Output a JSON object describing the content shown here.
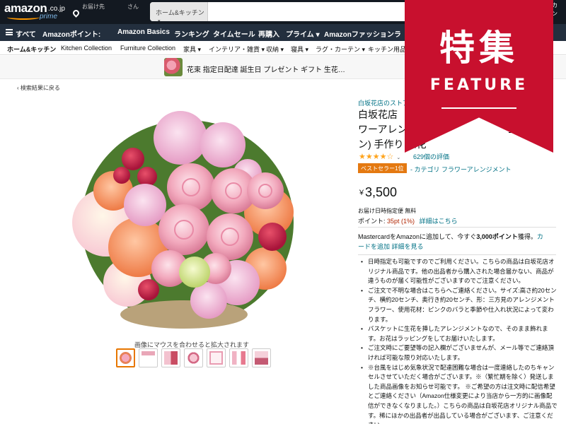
{
  "header": {
    "logo_main": "amazon",
    "logo_tld": ".co.jp",
    "logo_sub": "prime",
    "deliver_label": "お届け先",
    "deliver_name": "さん",
    "search_category": "ホーム&キッチン",
    "account_line1": "アカ",
    "account_line2": "ウン"
  },
  "nav": {
    "items": [
      "すべて",
      "Amazonポイント:",
      "Amazon Basics",
      "ランキング",
      "タイムセール",
      "再購入",
      "プライム ▾",
      "Amazonファッション",
      "ラ"
    ]
  },
  "subnav": {
    "items": [
      "ホーム&キッチン",
      "Kitchen Collection",
      "Furniture Collection",
      "家具 ▾",
      "インテリア・雑貨 ▾",
      "収納 ▾",
      "寝具 ▾",
      "ラグ・カーテン ▾",
      "キッチン用品 ▾"
    ]
  },
  "banner": {
    "text": "花束 指定日配達 誕生日 プレゼント ギフト 生花…"
  },
  "back_link": "‹ 検索結果に戻る",
  "image": {
    "zoom_hint": "画像にマウスを合わせると拡大されます",
    "thumb_count": 7
  },
  "product": {
    "store": "白坂花店のストア",
    "title": "白坂花店 ワーアレンジメ ン) 手作り 生花",
    "title_line1": "白坂花店",
    "title_line2": "ワーアレンジ",
    "title_line2b": "ョン",
    "title_line3": "ン) 手作り 生花",
    "rating": 4,
    "stars_text": "★★★★☆",
    "reviews": "629個の評価",
    "best_badge": "ベストセラー1位",
    "best_category": "- カテゴリ フラワーアレンジメント",
    "price_symbol": "￥",
    "price": "3,500",
    "delivery": "お届け日時指定便 無料",
    "points_label": "ポイント:",
    "points_value": "35pt (1%)",
    "points_link": "詳細はこちら",
    "mastercard_pre": "MastercardをAmazonに追加して、今すぐ",
    "mastercard_bold": "3,000ポイント",
    "mastercard_post": "獲得。",
    "mastercard_link1": "カ",
    "mastercard_link1b": "ードを追加",
    "mastercard_link2": "詳細を見る",
    "bullets": [
      "日時指定も可能ですのでご利用ください。こちらの商品は白坂花店オリジナル商品です。他の出品者から購入された場合届かない、商品が違うものが届く可能性がございますのでご注意ください。",
      "ご注文で不明な場合はこちらへご連絡ください。サイズ:高さ約20センチ、横約20センチ、奥行き約20センチ、形：三方見のアレンジメントフラワー、使用花材：ピンクのバラと季節や仕入れ状況によって変わります。",
      "バスケットに生花を挿したアレンジメントなので、そのまま飾れます。お花はラッピングをしてお届けいたします。",
      "ご注文時にご要望等の記入欄がございませんが、メール等でご連絡頂ければ可能な限り対応いたします。",
      "※台風をはじめ気象状況で配達困難な場合は一度連絡したのちキャンセルさせていただく場合がございます。※（繁忙期を除く）発送しました商品画像をお知らせ可能です。 ※ご希望の方は注文時に配信希望とご連絡ください（Amazon仕様変更により当店から一方的に画像配信ができなくなりました。）こちらの商品は白坂花店オリジナル商品です。稀にほかの出品者が出品している場合がございます、ご注意ください。"
    ]
  },
  "ribbon": {
    "jp": "特集",
    "en": "FEATURE"
  },
  "colors": {
    "header_bg": "#131921",
    "nav_bg": "#232f3e",
    "link": "#007185",
    "price_red": "#b12704",
    "star": "#ffa41c",
    "badge": "#e47911",
    "ribbon": "#c8102e"
  }
}
